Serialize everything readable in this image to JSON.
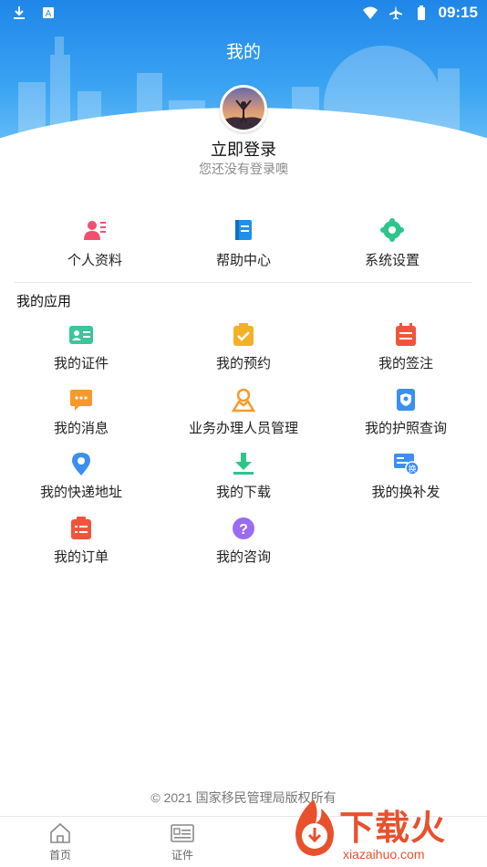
{
  "status": {
    "time": "09:15"
  },
  "header": {
    "title": "我的"
  },
  "profile": {
    "login_title": "立即登录",
    "login_subtitle": "您还没有登录噢"
  },
  "quick_actions": [
    {
      "label": "个人资料",
      "icon": "profile-card-icon",
      "color": "#f0506e"
    },
    {
      "label": "帮助中心",
      "icon": "help-book-icon",
      "color": "#1e90e8"
    },
    {
      "label": "系统设置",
      "icon": "gear-icon",
      "color": "#2ec58a"
    }
  ],
  "apps": {
    "section_title": "我的应用",
    "items": [
      {
        "label": "我的证件",
        "icon": "id-card-icon",
        "color": "#3cc59a"
      },
      {
        "label": "我的预约",
        "icon": "appointment-clipboard-icon",
        "color": "#f5b027"
      },
      {
        "label": "我的签注",
        "icon": "endorsement-calendar-icon",
        "color": "#f0553c"
      },
      {
        "label": "我的消息",
        "icon": "message-bubble-icon",
        "color": "#f59a2a"
      },
      {
        "label": "业务办理人员管理",
        "icon": "person-manage-icon",
        "color": "#f59a2a"
      },
      {
        "label": "我的护照查询",
        "icon": "passport-search-icon",
        "color": "#3a8ff0"
      },
      {
        "label": "我的快递地址",
        "icon": "location-pin-icon",
        "color": "#3a8ff0"
      },
      {
        "label": "我的下载",
        "icon": "download-icon",
        "color": "#2ec58a"
      },
      {
        "label": "我的换补发",
        "icon": "replace-card-icon",
        "color": "#3a8ff0"
      },
      {
        "label": "我的订单",
        "icon": "order-list-icon",
        "color": "#f0553c"
      },
      {
        "label": "我的咨询",
        "icon": "question-icon",
        "color": "#9a6cf0"
      }
    ]
  },
  "footer": {
    "copyright": "© 2021 国家移民管理局版权所有"
  },
  "tabbar": {
    "tabs": [
      {
        "label": "首页",
        "icon": "home-icon"
      },
      {
        "label": "证件",
        "icon": "document-card-icon"
      }
    ]
  },
  "watermark": {
    "brand": "下载火",
    "domain": "xiazaihuo.com"
  }
}
